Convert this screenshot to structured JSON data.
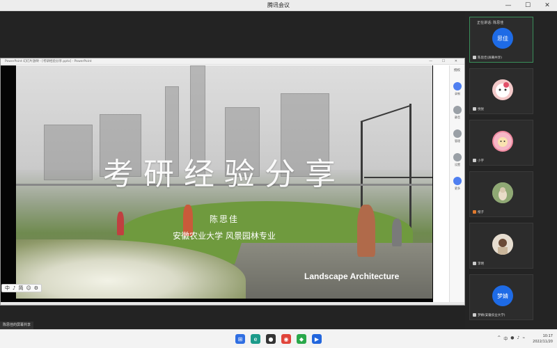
{
  "window": {
    "title": "腾讯会议",
    "controls": [
      "—",
      "☐",
      "✕"
    ]
  },
  "shared_window": {
    "title": "PowerPoint 幻灯片放映 - [考研经验分享.pptx] - PowerPoint",
    "controls": [
      "—",
      "☐",
      "✕"
    ]
  },
  "slide": {
    "title": "考研经验分享",
    "presenter": "陈思佳",
    "affiliation": "安徽农业大学 风景园林专业",
    "english_label": "Landscape Architecture"
  },
  "share_sidebar": {
    "header": "授权",
    "items": [
      {
        "label": "录制",
        "icon": "record-icon",
        "color": "#4f7ff0"
      },
      {
        "label": "静音",
        "icon": "mute-icon",
        "color": "#9aa0a6"
      },
      {
        "label": "管理",
        "icon": "manage-icon",
        "color": "#9aa0a6"
      },
      {
        "label": "设置",
        "icon": "settings-icon",
        "color": "#9aa0a6"
      },
      {
        "label": "更多",
        "icon": "more-icon",
        "color": "#4f7ff0"
      }
    ]
  },
  "ime_bar": {
    "items": [
      "中",
      "♪",
      "简",
      "☺",
      "⚙"
    ]
  },
  "participants": [
    {
      "top_text": "正在讲话: 陈思佳",
      "avatar_text": "思佳",
      "avatar_color": "#1e6be6",
      "name": "陈思佳(屏幕共享)",
      "active": true
    },
    {
      "avatar_text": "",
      "avatar_color": "#f3c9c9",
      "name": "悦悦"
    },
    {
      "avatar_text": "",
      "avatar_color": "#f08aa0",
      "name": "小宇"
    },
    {
      "avatar_text": "",
      "avatar_color": "#9fb58a",
      "name": "橙子"
    },
    {
      "avatar_text": "",
      "avatar_color": "#b9a58f",
      "name": "李明"
    },
    {
      "avatar_text": "梦婧",
      "avatar_color": "#1e6be6",
      "name": "梦婧(安徽农业大学)"
    }
  ],
  "share_note": "陈思佳的屏幕共享",
  "taskbar": {
    "apps": [
      {
        "name": "start-icon",
        "glyph": "⊞",
        "color": "#2f6ee2"
      },
      {
        "name": "edge-icon",
        "glyph": "e",
        "color": "#1b9a8a"
      },
      {
        "name": "app-icon-dark",
        "glyph": "●",
        "color": "#333333"
      },
      {
        "name": "chrome-icon",
        "glyph": "◉",
        "color": "#e0443a"
      },
      {
        "name": "app-icon-green",
        "glyph": "◆",
        "color": "#2aa84a"
      },
      {
        "name": "meeting-icon",
        "glyph": "▶",
        "color": "#2266dd"
      }
    ],
    "tray": [
      "^",
      "中",
      "●",
      "♪",
      "⌁"
    ],
    "time": "10:17",
    "date": "2022/11/20"
  }
}
